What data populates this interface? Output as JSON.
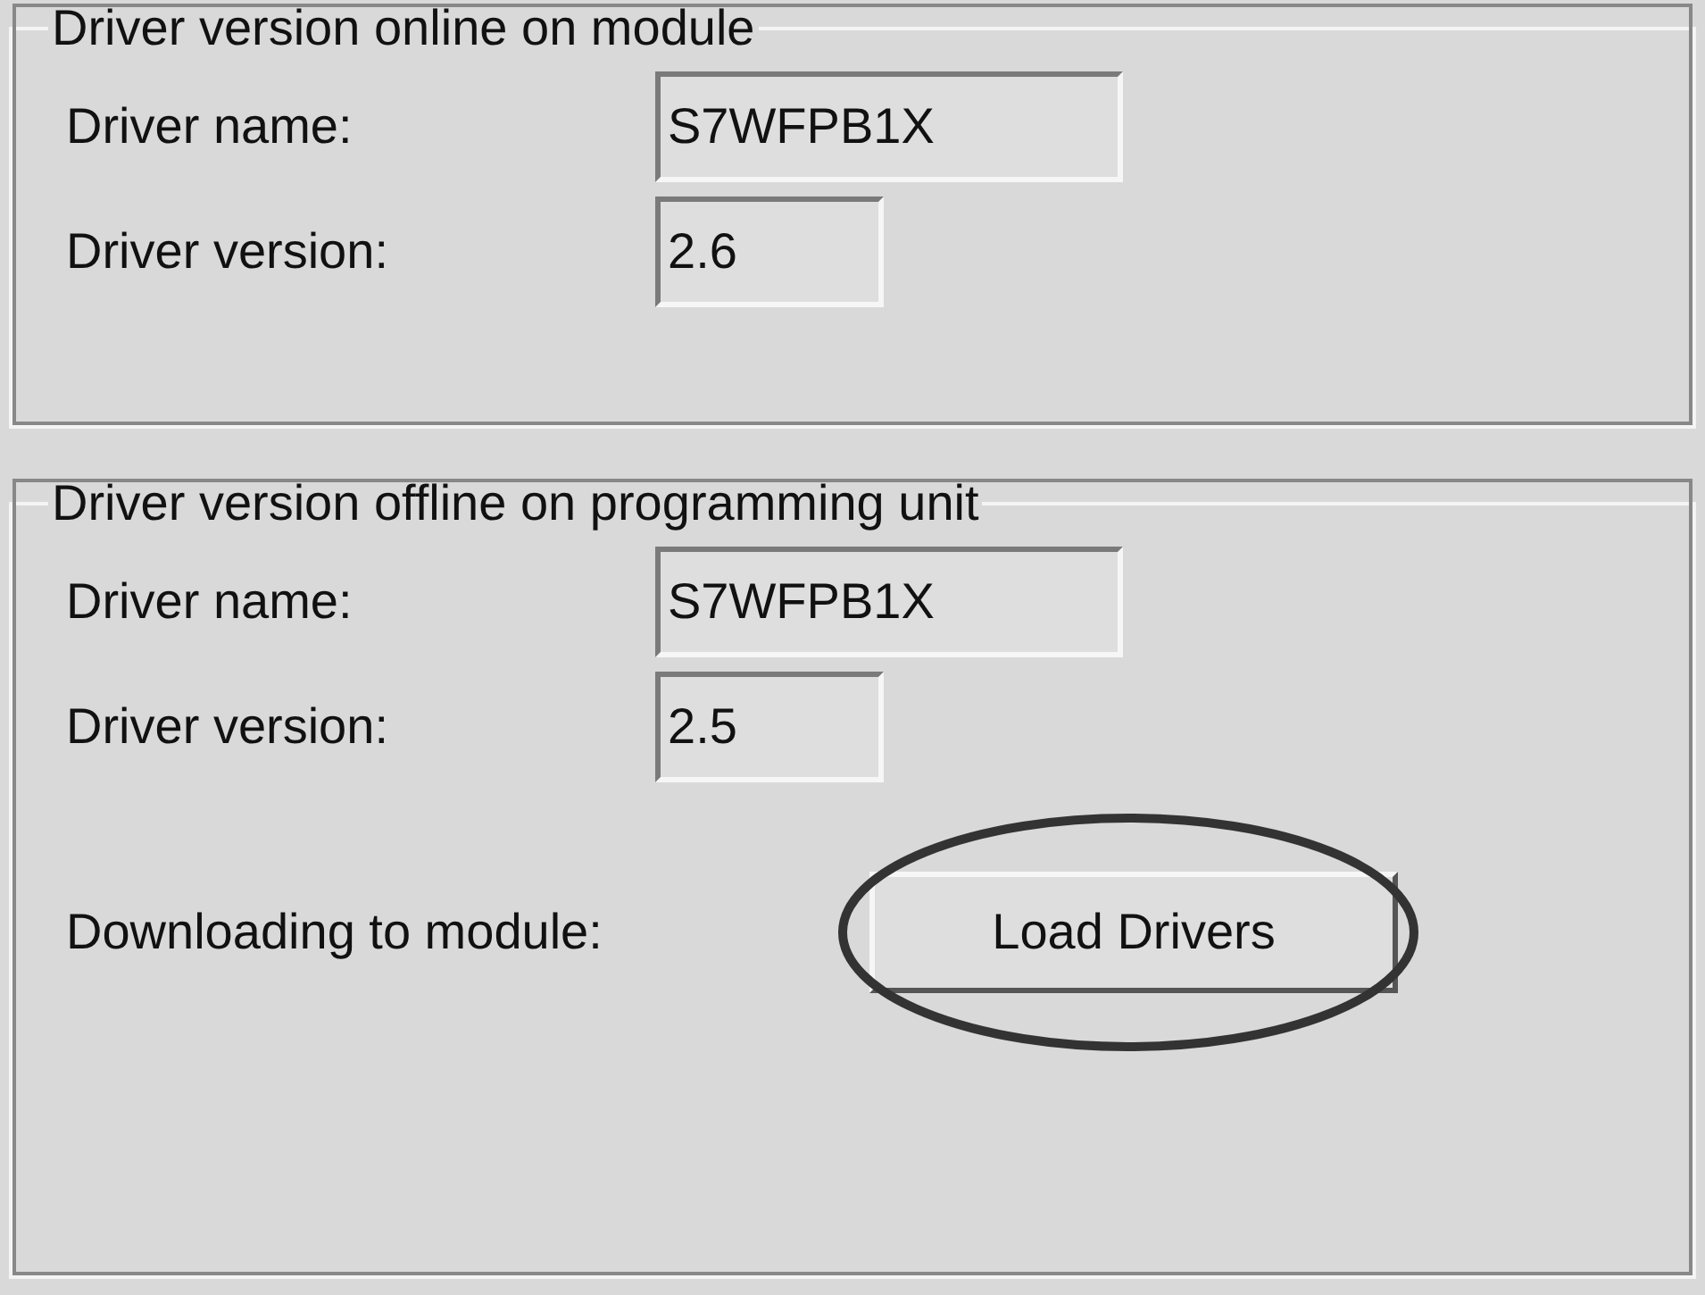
{
  "groups": [
    {
      "legend": "Driver version online on module",
      "rows": [
        {
          "kind": "field",
          "label": "Driver name:",
          "value": "S7WFPB1X",
          "wide": true
        },
        {
          "kind": "field",
          "label": "Driver version:",
          "value": "2.6",
          "wide": false
        }
      ]
    },
    {
      "legend": "Driver version offline on programming unit",
      "rows": [
        {
          "kind": "field",
          "label": "Driver name:",
          "value": "S7WFPB1X",
          "wide": true
        },
        {
          "kind": "field",
          "label": "Driver version:",
          "value": "2.5",
          "wide": false
        },
        {
          "kind": "button",
          "label": "Downloading to module:",
          "value": "Load Drivers",
          "circled": true
        }
      ]
    }
  ]
}
